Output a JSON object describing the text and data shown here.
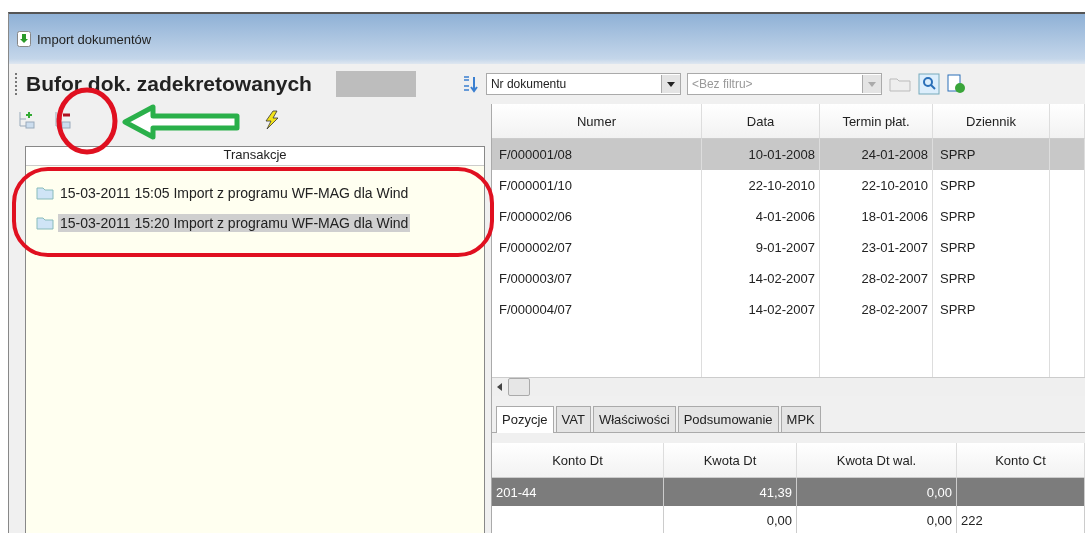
{
  "window": {
    "title": "Import dokumentów"
  },
  "header": {
    "title": "Bufor dok. zadekretowanych",
    "sort_field": "Nr dokumentu",
    "filter_placeholder": "<Bez filtru>"
  },
  "tree": {
    "header": "Transakcje",
    "items": [
      {
        "label": "15-03-2011 15:05 Import z programu WF-MAG dla Wind",
        "selected": false
      },
      {
        "label": "15-03-2011 15:20 Import z programu WF-MAG dla Wind",
        "selected": true
      }
    ]
  },
  "documents": {
    "columns": [
      "Numer",
      "Data",
      "Termin płat.",
      "Dziennik"
    ],
    "rows": [
      {
        "cells": [
          "F/000001/08",
          "10-01-2008",
          "24-01-2008",
          "SPRP"
        ],
        "selected": true
      },
      {
        "cells": [
          "F/000001/10",
          "22-10-2010",
          "22-10-2010",
          "SPRP"
        ],
        "selected": false
      },
      {
        "cells": [
          "F/000002/06",
          "4-01-2006",
          "18-01-2006",
          "SPRP"
        ],
        "selected": false
      },
      {
        "cells": [
          "F/000002/07",
          "9-01-2007",
          "23-01-2007",
          "SPRP"
        ],
        "selected": false
      },
      {
        "cells": [
          "F/000003/07",
          "14-02-2007",
          "28-02-2007",
          "SPRP"
        ],
        "selected": false
      },
      {
        "cells": [
          "F/000004/07",
          "14-02-2007",
          "28-02-2007",
          "SPRP"
        ],
        "selected": false
      }
    ]
  },
  "tabs": [
    {
      "label": "Pozycje",
      "selected": true
    },
    {
      "label": "VAT",
      "selected": false
    },
    {
      "label": "Właściwości",
      "selected": false
    },
    {
      "label": "Podsumowanie",
      "selected": false
    },
    {
      "label": "MPK",
      "selected": false
    }
  ],
  "entries": {
    "columns": [
      "Konto Dt",
      "Kwota Dt",
      "Kwota Dt wal.",
      "Konto Ct"
    ],
    "rows": [
      {
        "cells": [
          "201-44",
          "41,39",
          "0,00",
          ""
        ],
        "selected": true
      },
      {
        "cells": [
          "",
          "0,00",
          "0,00",
          "222"
        ],
        "selected": false
      }
    ]
  }
}
